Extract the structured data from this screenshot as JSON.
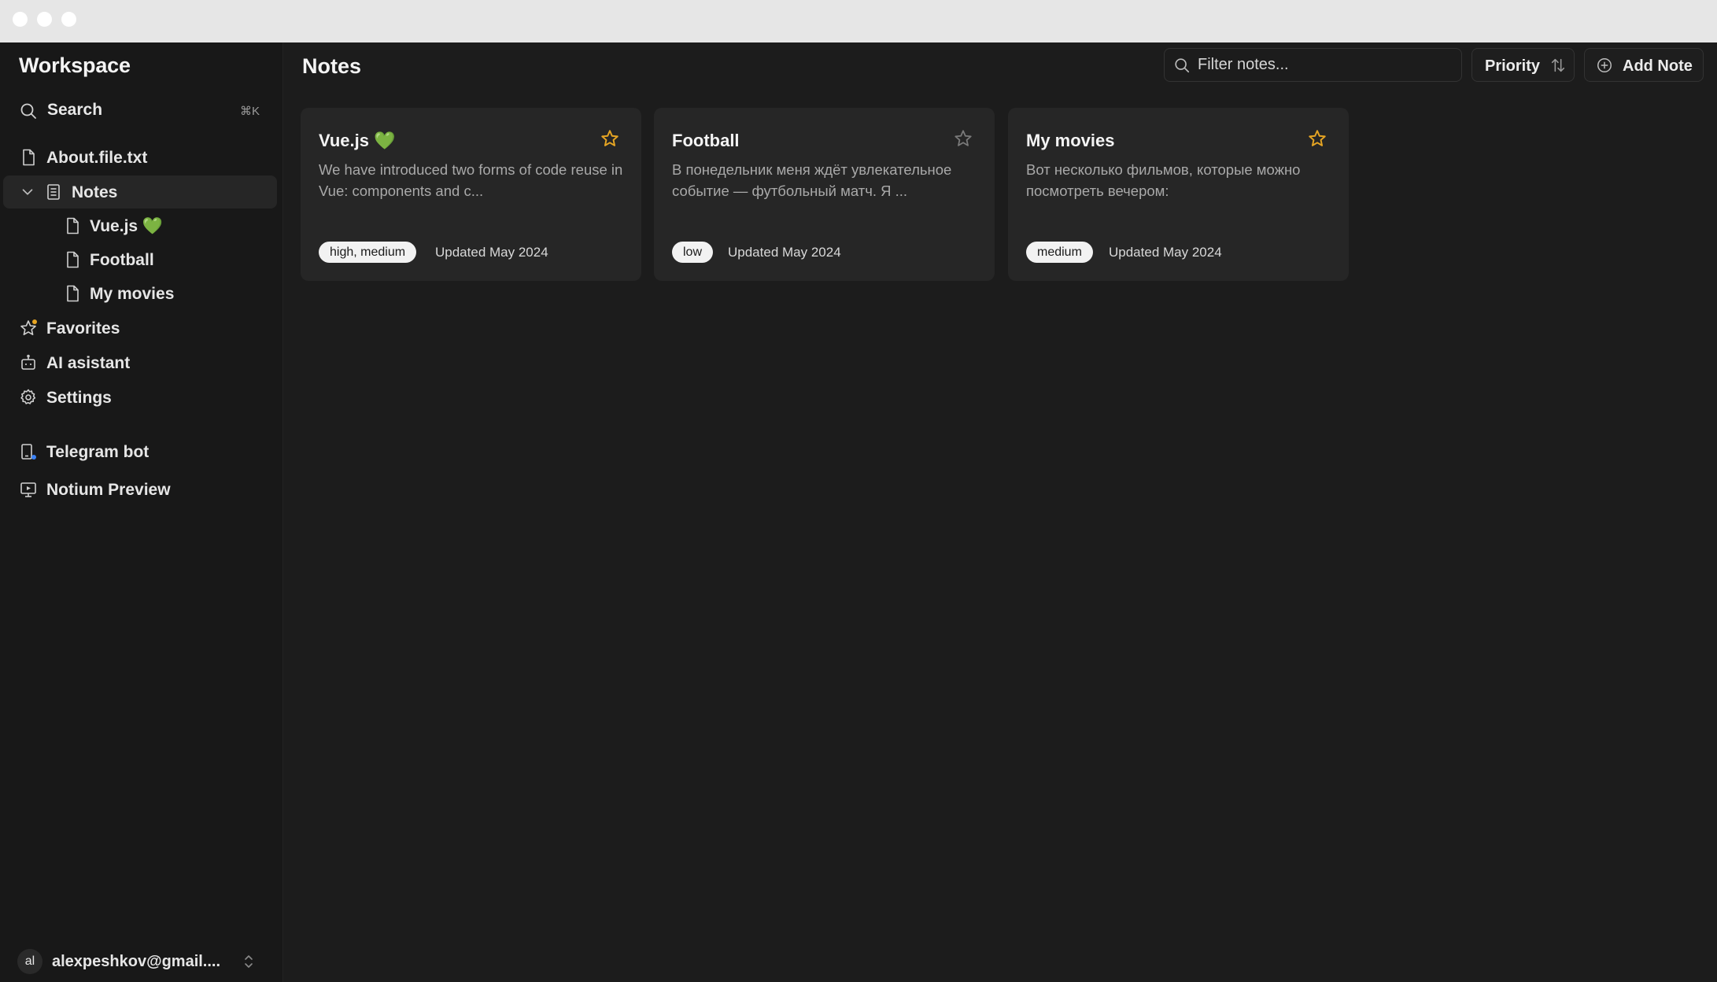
{
  "window": {
    "controls": [
      "close",
      "minimize",
      "maximize"
    ]
  },
  "sidebar": {
    "workspace_title": "Workspace",
    "search": {
      "label": "Search",
      "shortcut": "⌘K"
    },
    "items": [
      {
        "label": "About.file.txt",
        "icon": "file-icon"
      },
      {
        "label": "Notes",
        "icon": "notebook-icon",
        "expanded": true
      },
      {
        "label": "Vue.js 💚",
        "icon": "file-icon"
      },
      {
        "label": "Football",
        "icon": "file-icon"
      },
      {
        "label": "My movies",
        "icon": "file-icon"
      },
      {
        "label": "Favorites",
        "icon": "star-icon"
      },
      {
        "label": "AI asistant",
        "icon": "bot-icon"
      },
      {
        "label": "Settings",
        "icon": "gear-icon"
      },
      {
        "label": "Telegram bot",
        "icon": "device-icon"
      },
      {
        "label": "Notium Preview",
        "icon": "monitor-icon"
      }
    ],
    "user": {
      "initials": "al",
      "email": "alexpeshkov@gmail...."
    }
  },
  "main": {
    "title": "Notes",
    "filter": {
      "placeholder": "Filter notes..."
    },
    "sort_button": {
      "label": "Priority"
    },
    "add_button": {
      "label": "Add Note"
    },
    "cards": [
      {
        "title": "Vue.js 💚",
        "excerpt": "We have introduced two forms of code reuse in Vue: components and c...",
        "tag": "high, medium",
        "updated": "Updated May 2024",
        "favorite": true
      },
      {
        "title": "Football",
        "excerpt": "В понедельник меня ждёт увлекательное событие — футбольный матч. Я ...",
        "tag": "low",
        "updated": "Updated May 2024",
        "favorite": false
      },
      {
        "title": "My movies",
        "excerpt": "Вот несколько фильмов, которые можно посмотреть вечером:",
        "tag": "medium",
        "updated": "Updated May 2024",
        "favorite": true
      }
    ]
  },
  "colors": {
    "background": "#1c1c1c",
    "sidebar": "#181818",
    "card": "#262626",
    "accent_star": "#e6a523",
    "tag_bg": "#f2f2f2"
  }
}
